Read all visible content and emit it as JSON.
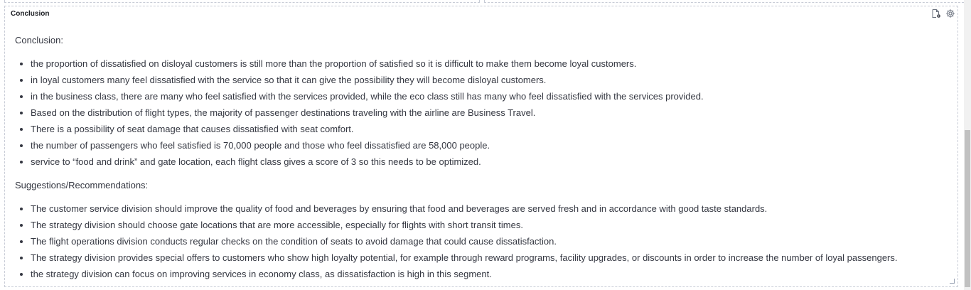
{
  "panel": {
    "title": "Conclusion",
    "icons": [
      "document-gear-icon",
      "gear-icon"
    ]
  },
  "content": {
    "conclusion_heading": "Conclusion:",
    "conclusion_items": [
      "the proportion of dissatisfied on disloyal customers is still more than the proportion of satisfied so it is difficult to make them become loyal customers.",
      "in loyal customers many feel dissatisfied with the service so that it can give the possibility they will become disloyal customers.",
      "in the business class, there are many who feel satisfied with the services provided, while the eco class still has many who feel dissatisfied with the services provided.",
      "Based on the distribution of flight types, the majority of passenger destinations traveling with the airline are Business Travel.",
      "There is a possibility of seat damage that causes dissatisfied with seat comfort.",
      "the number of passengers who feel satisfied is 70,000 people and those who feel dissatisfied are 58,000 people.",
      "service to “food and drink” and gate location, each flight class gives a score of 3 so this needs to be optimized."
    ],
    "suggestions_heading": "Suggestions/Recommendations:",
    "suggestion_items": [
      "The customer service division should improve the quality of food and beverages by ensuring that food and beverages are served fresh and in accordance with good taste standards.",
      "The strategy division should choose gate locations that are more accessible, especially for flights with short transit times.",
      "The flight operations division conducts regular checks on the condition of seats to avoid damage that could cause dissatisfaction.",
      "The strategy division provides special offers to customers who show high loyalty potential, for example through reward programs, facility upgrades, or discounts in order to increase the number of loyal passengers.",
      "the strategy division can focus on improving services in economy class, as dissatisfaction is high in this segment."
    ]
  },
  "scrollbar": {
    "scroll_position": 0.55
  }
}
